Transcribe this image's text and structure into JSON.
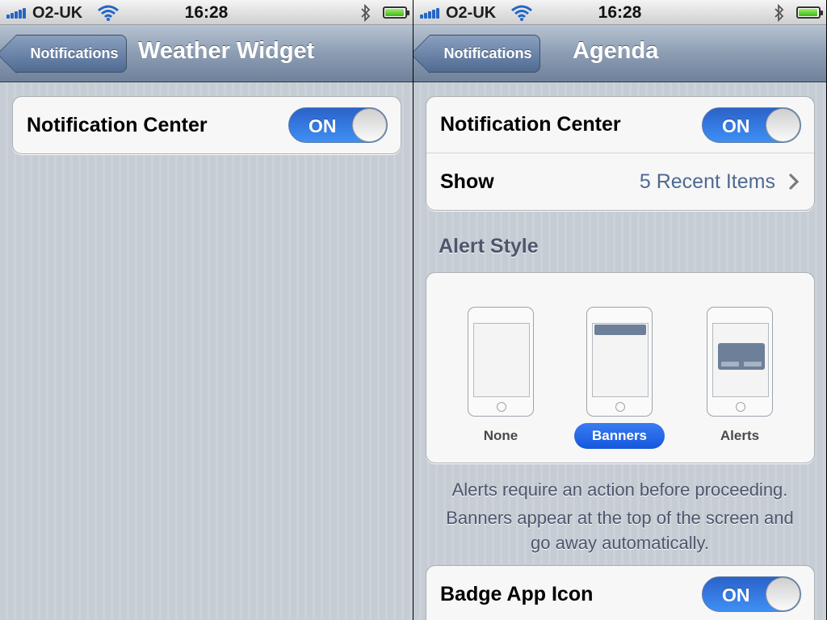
{
  "status_bar": {
    "carrier": "O2-UK",
    "time": "16:28",
    "battery_level": 0.9
  },
  "left_screen": {
    "back_label": "Notifications",
    "title": "Weather Widget",
    "rows": [
      {
        "label": "Notification Center",
        "toggle": "ON"
      }
    ]
  },
  "right_screen": {
    "back_label": "Notifications",
    "title": "Agenda",
    "rows": [
      {
        "label": "Notification Center",
        "toggle": "ON"
      },
      {
        "label": "Show",
        "value": "5 Recent Items"
      }
    ],
    "alert_style": {
      "header": "Alert Style",
      "options": [
        "None",
        "Banners",
        "Alerts"
      ],
      "selected": "Banners"
    },
    "footnote_1": "Alerts require an action before proceeding.",
    "footnote_2a": "Banners appear at the top of the screen and",
    "footnote_2b": "go away automatically.",
    "badge_row": {
      "label": "Badge App Icon",
      "toggle": "ON"
    }
  },
  "colors": {
    "accent": "#2f7ae5",
    "nav": "#8c9db3",
    "value_text": "#4d6a91"
  },
  "icons": [
    "signal-bars-icon",
    "wifi-icon",
    "bluetooth-icon",
    "battery-icon",
    "chevron-right-icon"
  ]
}
